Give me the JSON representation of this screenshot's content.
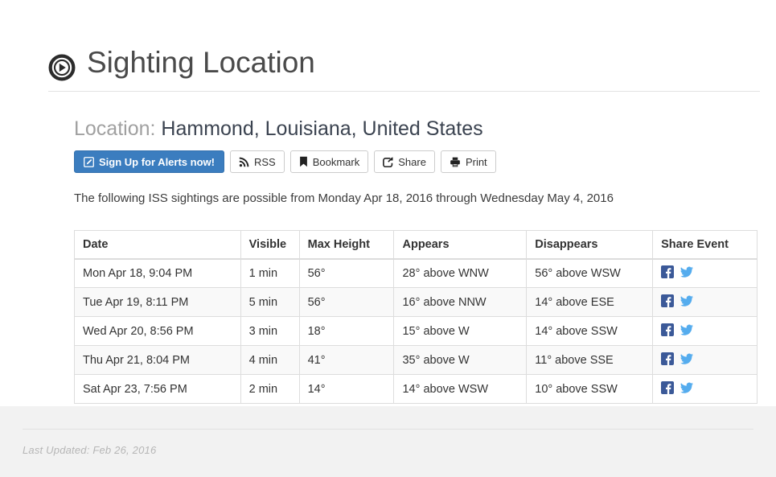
{
  "header": {
    "icon": "compass-icon",
    "title": "Sighting Location"
  },
  "location": {
    "label": "Location:",
    "value": "Hammond, Louisiana, United States"
  },
  "toolbar": {
    "buttons": [
      {
        "label": "Sign Up for Alerts now!",
        "icon": "edit-pencil-icon",
        "primary": true
      },
      {
        "label": "RSS",
        "icon": "rss-icon",
        "primary": false
      },
      {
        "label": "Bookmark",
        "icon": "bookmark-icon",
        "primary": false
      },
      {
        "label": "Share",
        "icon": "share-icon",
        "primary": false
      },
      {
        "label": "Print",
        "icon": "print-icon",
        "primary": false
      }
    ],
    "primary_color": "#3b7dbf"
  },
  "lead": "The following ISS sightings are possible from Monday Apr 18, 2016 through Wednesday May 4, 2016",
  "table": {
    "columns": [
      "Date",
      "Visible",
      "Max Height",
      "Appears",
      "Disappears",
      "Share Event"
    ],
    "rows": [
      {
        "date": "Mon Apr 18, 9:04 PM",
        "visible": "1 min",
        "max_height": "56°",
        "appears": "28° above WNW",
        "disappears": "56° above WSW",
        "share": [
          "facebook-icon",
          "twitter-icon"
        ]
      },
      {
        "date": "Tue Apr 19, 8:11 PM",
        "visible": "5 min",
        "max_height": "56°",
        "appears": "16° above NNW",
        "disappears": "14° above ESE",
        "share": [
          "facebook-icon",
          "twitter-icon"
        ]
      },
      {
        "date": "Wed Apr 20, 8:56 PM",
        "visible": "3 min",
        "max_height": "18°",
        "appears": "15° above W",
        "disappears": "14° above SSW",
        "share": [
          "facebook-icon",
          "twitter-icon"
        ]
      },
      {
        "date": "Thu Apr 21, 8:04 PM",
        "visible": "4 min",
        "max_height": "41°",
        "appears": "35° above W",
        "disappears": "11° above SSE",
        "share": [
          "facebook-icon",
          "twitter-icon"
        ]
      },
      {
        "date": "Sat Apr 23, 7:56 PM",
        "visible": "2 min",
        "max_height": "14°",
        "appears": "14° above WSW",
        "disappears": "10° above SSW",
        "share": [
          "facebook-icon",
          "twitter-icon"
        ]
      }
    ]
  },
  "footer": {
    "last_updated": "Last Updated: Feb 26, 2016"
  },
  "colors": {
    "facebook": "#3b5998",
    "twitter": "#55acee",
    "page_background": "#f2f2f2"
  }
}
